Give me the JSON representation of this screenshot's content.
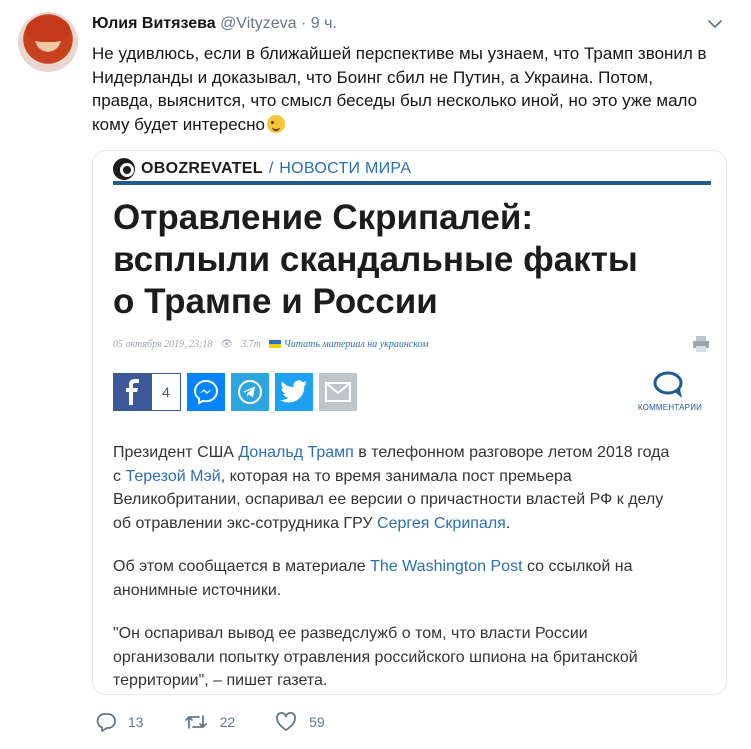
{
  "tweet": {
    "author_name": "Юлия Витязева",
    "handle": "@Vityzeva",
    "separator": "·",
    "time": "9 ч.",
    "text_lines": [
      "Не удивлюсь, если в ближайшей перспективе мы узнаем, что Трамп звонил в",
      "Нидерланды и доказывал, что Боинг сбил не Путин, а Украина. Потом,",
      "правда, выяснится, что смысл беседы был несколько иной, но это уже мало",
      "кому будет интересно"
    ],
    "emoji": "winking-smile"
  },
  "card": {
    "brand_name": "OBOZREVATEL",
    "brand_separator": "/",
    "brand_section": "НОВОСТИ МИРА",
    "accent_color": "#1f5a94",
    "headline_lines": [
      "Отравление Скрипалей:",
      "всплыли скандальные факты",
      "о Трампе и России"
    ],
    "meta": {
      "date": "05 октября 2019, 23:18",
      "views": "3.7т",
      "ukrainian_link": "Читать материал на украинском"
    },
    "share": {
      "facebook_count": "4"
    },
    "comments_label": "КОММЕНТАРИИ",
    "para1": {
      "l1a": "Президент США ",
      "l1b": "Дональд Трамп",
      "l1c": " в телефонном разговоре летом 2018 года",
      "l2a": "с ",
      "l2b": "Терезой Мэй",
      "l2c": ", которая на то время занимала пост премьера",
      "l3": "Великобритании, оспаривал ее версии о причастности властей РФ к делу",
      "l4a": "об отравлении экс-сотрудника ГРУ ",
      "l4b": "Сергея Скрипаля",
      "l4c": "."
    },
    "para2": {
      "l1a": "Об этом сообщается в материале ",
      "l1b": "The Washington Post",
      "l1c": " со ссылкой на",
      "l2": "анонимные источники."
    },
    "para3": {
      "l1": "\"Он оспаривал вывод ее разведслужб о том, что власти России",
      "l2": "организовали попытку отравления российского шпиона на британской",
      "l3": "территории\", – пишет газета."
    }
  },
  "actions": {
    "replies": "13",
    "retweets": "22",
    "likes": "59"
  }
}
